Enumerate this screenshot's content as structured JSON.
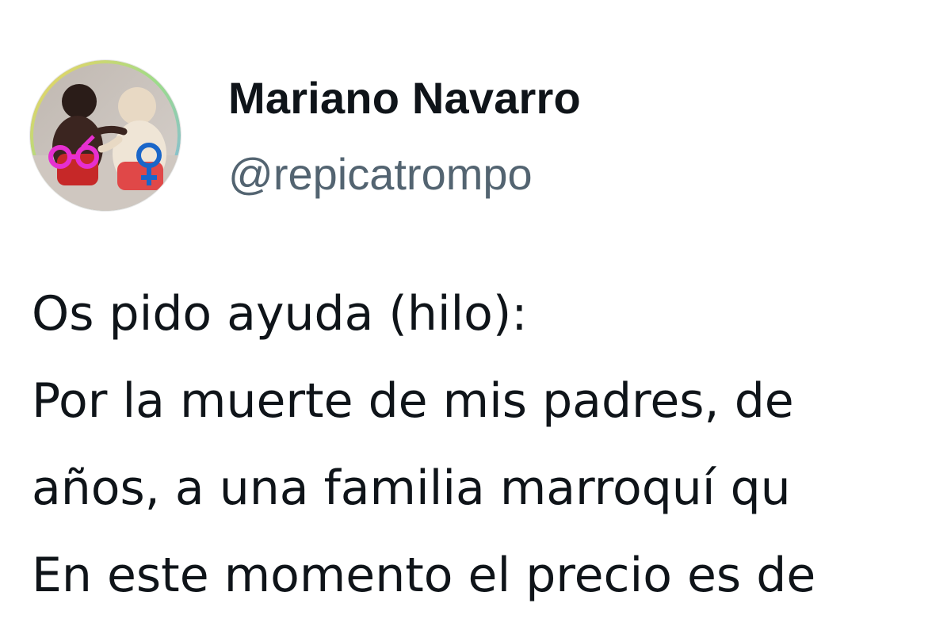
{
  "user": {
    "display_name": "Mariano Navarro",
    "handle": "@repicatrompo"
  },
  "tweet": {
    "lines": [
      "Os pido ayuda (hilo):",
      "Por la muerte de mis padres, de",
      "años, a una familia marroquí qu",
      "En este momento el precio es de"
    ]
  },
  "colors": {
    "name": "#0f1419",
    "handle": "#536471",
    "symbol_magenta": "#e62fd0",
    "symbol_blue": "#1a66c9"
  }
}
